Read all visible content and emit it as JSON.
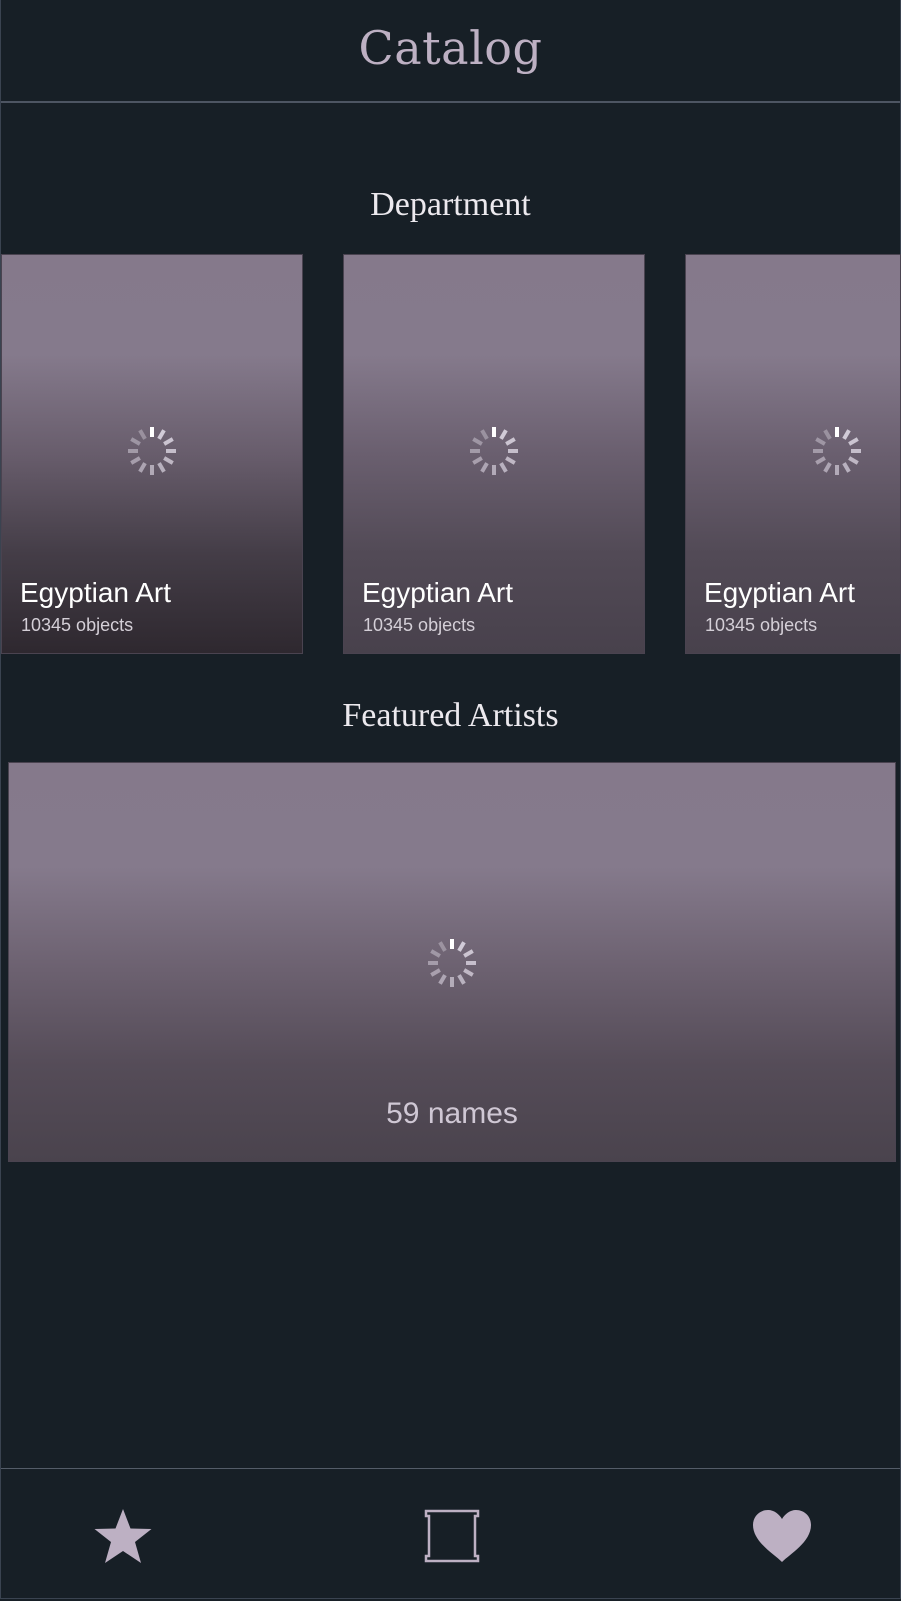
{
  "header": {
    "title": "Catalog"
  },
  "departments": {
    "section_title": "Department",
    "cards": [
      {
        "title": "Egyptian Art",
        "subtitle": "10345 objects"
      },
      {
        "title": "Egyptian Art",
        "subtitle": "10345 objects"
      },
      {
        "title": "Egyptian Art",
        "subtitle": "10345 objects"
      }
    ]
  },
  "featured": {
    "section_title": "Featured Artists",
    "count_label": "59 names"
  },
  "tabbar": {
    "items": [
      {
        "icon": "star-icon"
      },
      {
        "icon": "frame-icon"
      },
      {
        "icon": "heart-icon"
      }
    ]
  },
  "colors": {
    "background": "#171f26",
    "accent": "#bdb0c3",
    "card_top": "#85798b",
    "card_bottom": "#48414c"
  }
}
